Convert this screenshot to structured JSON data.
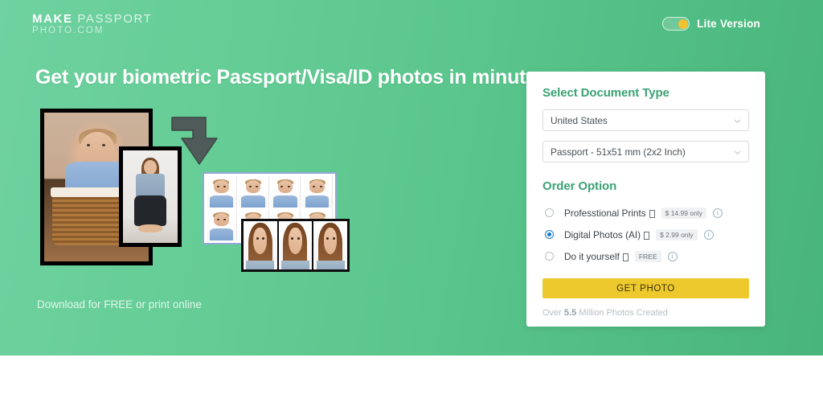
{
  "brand": {
    "logo_line1_bold": "MAKE",
    "logo_line1_light": " PASSPORT",
    "logo_line2": "PHOTO.COM",
    "accent_green": "#3BA273",
    "hero_green_left": "#6FD2A0",
    "hero_green_right": "#48B57C",
    "cta_yellow": "#EDC92E",
    "radio_blue": "#1878D1"
  },
  "header": {
    "toggle_label": "Lite Version",
    "toggle_state": "on",
    "toggle_knob_color": "#F2C230"
  },
  "hero": {
    "headline": "Get your biometric Passport/Visa/ID photos in minutes",
    "subline": "Download for FREE or print online"
  },
  "card": {
    "document_heading": "Select Document Type",
    "country_select": {
      "value": "United States",
      "icon": "chevron-down-icon"
    },
    "doctype_select": {
      "value": "Passport - 51x51 mm (2x2 Inch)",
      "icon": "chevron-down-icon"
    },
    "order_heading": "Order Option",
    "options": [
      {
        "label": "Professtional Prints",
        "badge": "$ 14.99 only",
        "selected": false,
        "info_icon": "info-icon"
      },
      {
        "label": "Digital Photos (AI)",
        "badge": "$ 2.99 only",
        "selected": true,
        "info_icon": "info-icon"
      },
      {
        "label": "Do it yourself",
        "badge": "FREE",
        "selected": false,
        "info_icon": "info-icon"
      }
    ],
    "cta_label": "GET PHOTO",
    "counter_prefix": "Over ",
    "counter_number": "5.5",
    "counter_suffix": " Million Photos Created"
  },
  "collage": {
    "arrow_icon": "elbow-arrow-down-icon",
    "source_photo_1": "baby-in-basket-photo",
    "source_photo_2": "woman-sitting-photo",
    "result_sheet_1": "baby-passport-photo-sheet",
    "result_sheet_2": "woman-passport-photo-sheet"
  }
}
